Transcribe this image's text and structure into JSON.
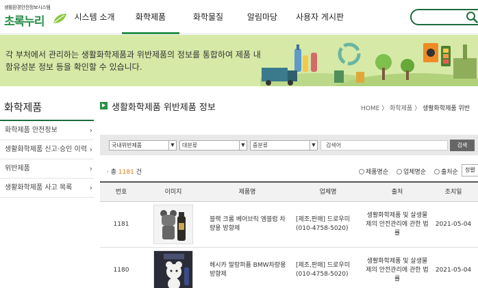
{
  "header": {
    "logo_sub": "생활환경안전정보시스템",
    "logo_main": "초록누리",
    "nav": [
      "시스템 소개",
      "화학제품",
      "화학물질",
      "알림마당",
      "사용자 게시판"
    ],
    "active_nav": "화학제품",
    "brand_color": "#2a8f4a"
  },
  "banner": {
    "line1": "각 부처에서 관리하는 생활화학제품과 위반제품의 정보를 통합하여 제품 내",
    "line2": "함유성분 정보 등을 확인할 수 있습니다."
  },
  "sidebar": {
    "title": "화학제품",
    "items": [
      {
        "label": "화학제품 안전정보"
      },
      {
        "label": "생활화학제품 신고·승인 이력"
      },
      {
        "label": "위반제품"
      },
      {
        "label": "생활화학제품 사고 목록"
      }
    ]
  },
  "main": {
    "title": "생활화학제품 위반제품 정보",
    "breadcrumb": [
      "HOME",
      "화학제품",
      "생활화학제품 위반"
    ],
    "filters": {
      "sel1": "국내위반제품",
      "sel2": "대분류",
      "sel3": "중분류",
      "keyword_placeholder": "검색어",
      "search_button": "검색"
    },
    "count_prefix": "· 총",
    "count_value": "1181",
    "count_suffix": "건",
    "sort_options": [
      "제품명순",
      "업체명순",
      "출처순"
    ],
    "sort_select": "정렬"
  },
  "table": {
    "headers": [
      "번호",
      "이미지",
      "제품명",
      "업체명",
      "출처",
      "조치일"
    ],
    "rows": [
      {
        "no": "1181",
        "product": "블랙 크롬 베어브릭 엠블럼 차량용 방향제",
        "company": "[제조,판매] 드로우미(010-4758-5020)",
        "source": "생활화학제품 및 살생물제의 안전관리에 관한 법률",
        "date": "2021-05-04"
      },
      {
        "no": "1180",
        "product": "헤시카 말랑퍼퓸 BMW차량용 방향제",
        "company": "[제조,판매] 드로우미(010-4758-5020)",
        "source": "생활화학제품 및 살생물제의 안전관리에 관한 법률",
        "date": "2021-05-04"
      }
    ]
  }
}
